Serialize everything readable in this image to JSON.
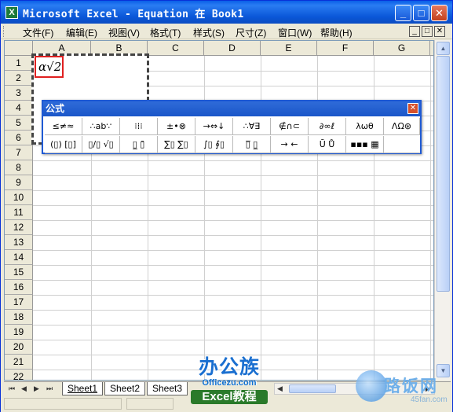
{
  "window": {
    "app_icon": "X",
    "title": "Microsoft Excel - Equation 在 Book1",
    "controls": {
      "minimize": "_",
      "maximize": "□",
      "close": "✕"
    }
  },
  "menu": {
    "items": [
      "文件(F)",
      "编辑(E)",
      "视图(V)",
      "格式(T)",
      "样式(S)",
      "尺寸(Z)",
      "窗口(W)",
      "帮助(H)"
    ],
    "doc_controls": [
      "_",
      "□",
      "✕"
    ]
  },
  "sheet": {
    "columns": [
      "A",
      "B",
      "C",
      "D",
      "E",
      "F",
      "G"
    ],
    "rows": [
      "1",
      "2",
      "3",
      "4",
      "5",
      "6",
      "7",
      "8",
      "9",
      "10",
      "11",
      "12",
      "13",
      "14",
      "15",
      "16",
      "17",
      "18",
      "19",
      "20",
      "21",
      "22"
    ],
    "equation_text": "α√2"
  },
  "equation_toolbar": {
    "title": "公式",
    "close": "✕",
    "row1": [
      "≤≠≈",
      "∴ab∵",
      "⁝⁞⁝",
      "±•⊗",
      "→⇔↓",
      "∴∀∃",
      "∉∩⊂",
      "∂∞ℓ",
      "λωθ",
      "ΛΩ⊛"
    ],
    "row2": [
      "(▯) [▯]",
      "▯/▯ √▯",
      "▯̲ ▯̄",
      "∑▯ ∑▯",
      "∫▯ ∮▯",
      "▯̅ ▯̲",
      "→ ←",
      "Ū Ů",
      "▪▪▪ ▦"
    ]
  },
  "tabs": {
    "nav": [
      "⏮",
      "◀",
      "▶",
      "⏭"
    ],
    "sheets": [
      "Sheet1",
      "Sheet2",
      "Sheet3"
    ],
    "active": "Sheet1"
  },
  "scrollbar": {
    "up": "▲",
    "down": "▼",
    "left": "◀",
    "right": "▶"
  },
  "watermarks": {
    "brand": "办公族",
    "url": "Officezu.com",
    "tagline": "Excel教程",
    "right_name": "路饭网",
    "right_site": "45fan.com"
  },
  "colors": {
    "titlebar": "#0a57d8",
    "menubar": "#ece9d8",
    "equation_box_border": "#e02020",
    "toolbar_border": "#1f5ad4"
  }
}
